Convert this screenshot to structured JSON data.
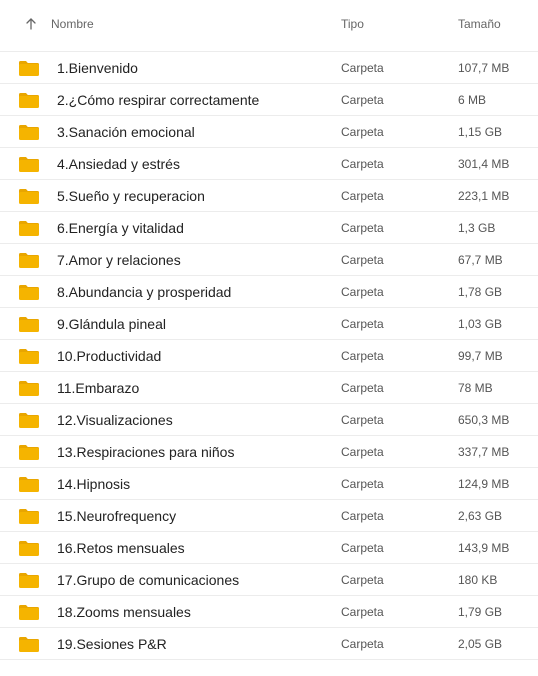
{
  "header": {
    "name_label": "Nombre",
    "type_label": "Tipo",
    "size_label": "Tamaño",
    "sort_icon": "arrow-up-icon"
  },
  "colors": {
    "folder": "#F5B400",
    "folder_tab": "#E9A600",
    "border": "#ECECEC",
    "header_text": "#666666"
  },
  "rows": [
    {
      "name": "1.Bienvenido",
      "type": "Carpeta",
      "size": "107,7 MB",
      "icon": "folder-icon"
    },
    {
      "name": "2.¿Cómo respirar correctamente",
      "type": "Carpeta",
      "size": "6 MB",
      "icon": "folder-icon"
    },
    {
      "name": "3.Sanación emocional",
      "type": "Carpeta",
      "size": "1,15 GB",
      "icon": "folder-icon"
    },
    {
      "name": "4.Ansiedad y estrés",
      "type": "Carpeta",
      "size": "301,4 MB",
      "icon": "folder-icon"
    },
    {
      "name": "5.Sueño y recuperacion",
      "type": "Carpeta",
      "size": "223,1 MB",
      "icon": "folder-icon"
    },
    {
      "name": "6.Energía y vitalidad",
      "type": "Carpeta",
      "size": "1,3 GB",
      "icon": "folder-icon"
    },
    {
      "name": "7.Amor y relaciones",
      "type": "Carpeta",
      "size": "67,7 MB",
      "icon": "folder-icon"
    },
    {
      "name": "8.Abundancia y prosperidad",
      "type": "Carpeta",
      "size": "1,78 GB",
      "icon": "folder-icon"
    },
    {
      "name": "9.Glándula pineal",
      "type": "Carpeta",
      "size": "1,03 GB",
      "icon": "folder-icon"
    },
    {
      "name": "10.Productividad",
      "type": "Carpeta",
      "size": "99,7 MB",
      "icon": "folder-icon"
    },
    {
      "name": "11.Embarazo",
      "type": "Carpeta",
      "size": "78 MB",
      "icon": "folder-icon"
    },
    {
      "name": "12.Visualizaciones",
      "type": "Carpeta",
      "size": "650,3 MB",
      "icon": "folder-icon"
    },
    {
      "name": "13.Respiraciones para niños",
      "type": "Carpeta",
      "size": "337,7 MB",
      "icon": "folder-icon"
    },
    {
      "name": "14.Hipnosis",
      "type": "Carpeta",
      "size": "124,9 MB",
      "icon": "folder-icon"
    },
    {
      "name": "15.Neurofrequency",
      "type": "Carpeta",
      "size": "2,63 GB",
      "icon": "folder-icon"
    },
    {
      "name": "16.Retos mensuales",
      "type": "Carpeta",
      "size": "143,9 MB",
      "icon": "folder-icon"
    },
    {
      "name": "17.Grupo de comunicaciones",
      "type": "Carpeta",
      "size": "180 KB",
      "icon": "folder-icon"
    },
    {
      "name": "18.Zooms mensuales",
      "type": "Carpeta",
      "size": "1,79 GB",
      "icon": "folder-icon"
    },
    {
      "name": "19.Sesiones P&R",
      "type": "Carpeta",
      "size": "2,05 GB",
      "icon": "folder-icon"
    }
  ]
}
